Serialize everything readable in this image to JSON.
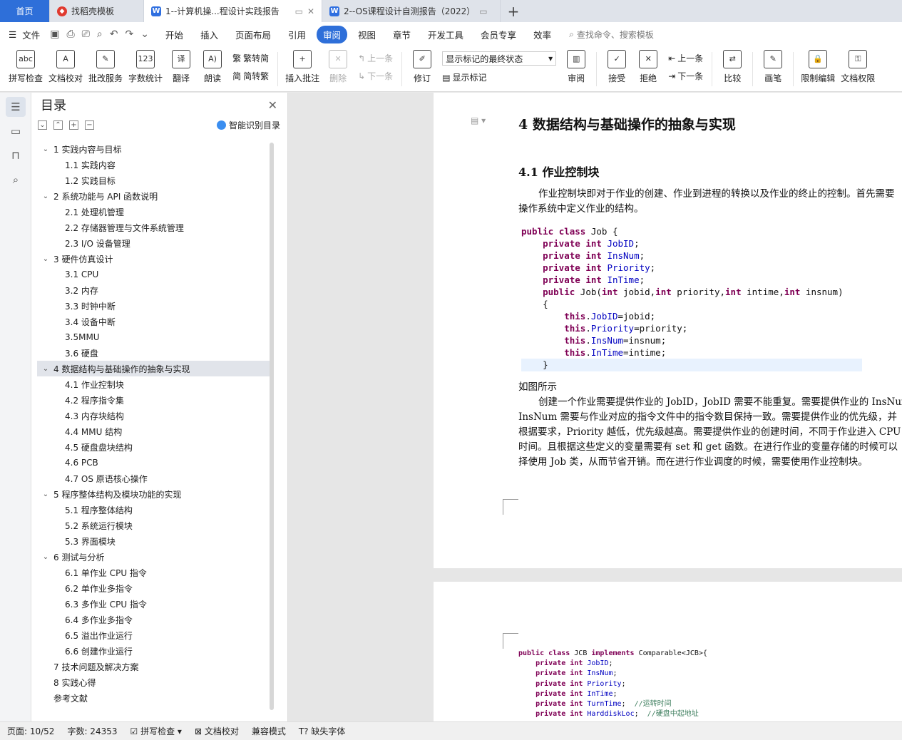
{
  "tabs": [
    {
      "label": "首页"
    },
    {
      "label": "找稻壳模板"
    },
    {
      "label": "1--计算机操...程设计实践报告"
    },
    {
      "label": "2--OS课程设计自测报告（2022）"
    }
  ],
  "menubar": {
    "file": "文件",
    "items": [
      "开始",
      "插入",
      "页面布局",
      "引用",
      "审阅",
      "视图",
      "章节",
      "开发工具",
      "会员专享",
      "效率"
    ],
    "search": "查找命令、搜索模板"
  },
  "ribbon": {
    "spell": "拼写检查",
    "proof": "文档校对",
    "batch": "批改服务",
    "wordcount": "字数统计",
    "translate": "翻译",
    "read": "朗读",
    "trad": "繁转简",
    "simp": "简转繁",
    "insert_comment": "插入批注",
    "delete": "删除",
    "prev_comment": "上一条",
    "next_comment": "下一条",
    "revise": "修订",
    "markup_state": "显示标记的最终状态",
    "show_markup": "显示标记",
    "review": "审阅",
    "accept": "接受",
    "reject": "拒绝",
    "prev": "上一条",
    "next": "下一条",
    "compare": "比较",
    "pen": "画笔",
    "restrict": "限制编辑",
    "perm": "文档权限"
  },
  "toc": {
    "title": "目录",
    "smart": "智能识别目录",
    "items": [
      {
        "text": "1 实践内容与目标",
        "level": 1,
        "caret": true
      },
      {
        "text": "1.1 实践内容",
        "level": 2
      },
      {
        "text": "1.2 实践目标",
        "level": 2
      },
      {
        "text": "2 系统功能与 API 函数说明",
        "level": 1,
        "caret": true
      },
      {
        "text": "2.1 处理机管理",
        "level": 2
      },
      {
        "text": "2.2  存储器管理与文件系统管理",
        "level": 2
      },
      {
        "text": "2.3 I/O 设备管理",
        "level": 2
      },
      {
        "text": "3 硬件仿真设计",
        "level": 1,
        "caret": true
      },
      {
        "text": "3.1 CPU",
        "level": 2
      },
      {
        "text": "3.2 内存",
        "level": 2
      },
      {
        "text": "3.3 时钟中断",
        "level": 2
      },
      {
        "text": "3.4 设备中断",
        "level": 2
      },
      {
        "text": "3.5MMU",
        "level": 2
      },
      {
        "text": "3.6 硬盘",
        "level": 2
      },
      {
        "text": "4 数据结构与基础操作的抽象与实现",
        "level": 1,
        "caret": true,
        "active": true
      },
      {
        "text": "4.1  作业控制块",
        "level": 2
      },
      {
        "text": "4.2  程序指令集",
        "level": 2
      },
      {
        "text": "4.3  内存块结构",
        "level": 2
      },
      {
        "text": "4.4    MMU 结构",
        "level": 2
      },
      {
        "text": "4.5  硬盘盘块结构",
        "level": 2
      },
      {
        "text": "4.6 PCB",
        "level": 2
      },
      {
        "text": "4.7 OS 原语核心操作",
        "level": 2
      },
      {
        "text": "5 程序整体结构及模块功能的实现",
        "level": 1,
        "caret": true
      },
      {
        "text": "5.1  程序整体结构",
        "level": 2
      },
      {
        "text": "5.2  系统运行模块",
        "level": 2
      },
      {
        "text": "5.3  界面模块",
        "level": 2
      },
      {
        "text": "6 测试与分析",
        "level": 1,
        "caret": true
      },
      {
        "text": "6.1  单作业 CPU 指令",
        "level": 2
      },
      {
        "text": "6.2  单作业多指令",
        "level": 2
      },
      {
        "text": "6.3  多作业 CPU 指令",
        "level": 2
      },
      {
        "text": "6.4  多作业多指令",
        "level": 2
      },
      {
        "text": "6.5  溢出作业运行",
        "level": 2
      },
      {
        "text": "6.6  创建作业运行",
        "level": 2
      },
      {
        "text": "7 技术问题及解决方案",
        "level": 1,
        "caret": false
      },
      {
        "text": "8 实践心得",
        "level": 1,
        "caret": false
      },
      {
        "text": "参考文献",
        "level": 1,
        "caret": false
      }
    ]
  },
  "doc": {
    "h1": "4  数据结构与基础操作的抽象与实现",
    "h2": "4.1  作业控制块",
    "para1_l1": "作业控制块即对于作业的创建、作业到进程的转换以及作业的终止的控制。首先需要",
    "para1_l2": "操作系统中定义作业的结构。",
    "code1": [
      "public class Job {",
      "    private int JobID;",
      "    private int InsNum;",
      "    private int Priority;",
      "    private int InTime;",
      "    public Job(int jobid,int priority,int intime,int insnum)",
      "    {",
      "        this.JobID=jobid;",
      "        this.Priority=priority;",
      "        this.InsNum=insnum;",
      "        this.InTime=intime;",
      "    }"
    ],
    "caption": "如图所示",
    "para2": [
      "创建一个作业需要提供作业的 JobID，JobID 需要不能重复。需要提供作业的 InsNum",
      "InsNum 需要与作业对应的指令文件中的指令数目保持一致。需要提供作业的优先级，并",
      "根据要求，Priority 越低，优先级越高。需要提供作业的创建时间，不同于作业进入 CPU",
      "时间。且根据这些定义的变量需要有 set 和 get 函数。在进行作业的变量存储的时候可以",
      "择使用 Job 类，从而节省开销。而在进行作业调度的时候，需要使用作业控制块。"
    ],
    "code2": [
      "public class JCB implements Comparable<JCB>{",
      "    private int JobID;",
      "    private int InsNum;",
      "    private int Priority;",
      "    private int InTime;",
      "    private int TurnTime;  //运转时间",
      "    private int HarddiskLoc;  //硬盘中起地址"
    ]
  },
  "status": {
    "page": "页面: 10/52",
    "words": "字数: 24353",
    "spell": "拼写检查",
    "proof": "文档校对",
    "compat": "兼容模式",
    "missing_font": "缺失字体"
  }
}
